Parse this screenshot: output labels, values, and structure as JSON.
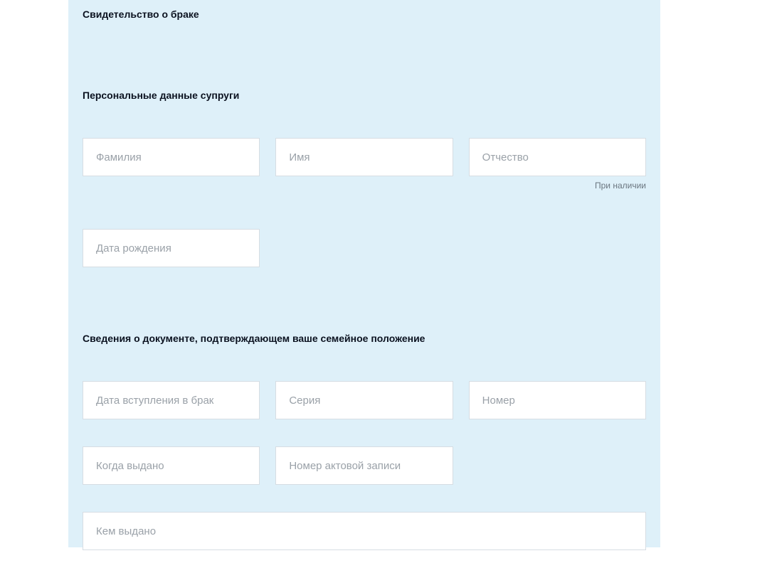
{
  "section1": {
    "title": "Свидетельство о браке"
  },
  "section2": {
    "title": "Персональные данные супруги",
    "fields": {
      "surname_placeholder": "Фамилия",
      "name_placeholder": "Имя",
      "patronymic_placeholder": "Отчество",
      "patronymic_hint": "При наличии",
      "dob_placeholder": "Дата рождения"
    }
  },
  "section3": {
    "title": "Сведения о документе, подтверждающем ваше семейное положение",
    "fields": {
      "marriage_date_placeholder": "Дата вступления в брак",
      "series_placeholder": "Серия",
      "number_placeholder": "Номер",
      "issue_date_placeholder": "Когда выдано",
      "act_record_number_placeholder": "Номер актовой записи",
      "issued_by_placeholder": "Кем выдано"
    }
  }
}
